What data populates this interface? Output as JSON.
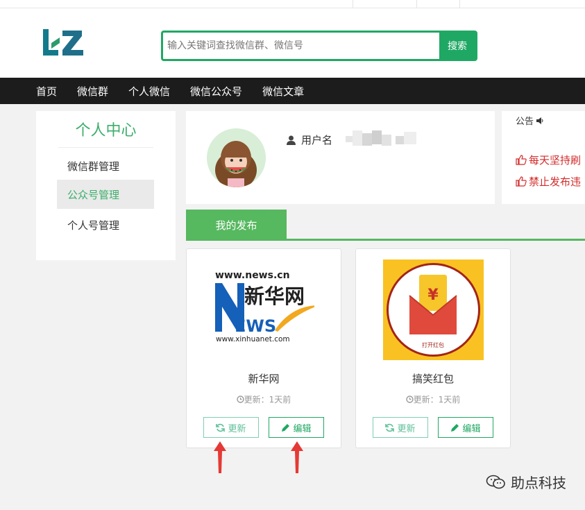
{
  "search": {
    "placeholder": "输入关键词查找微信群、微信号",
    "button": "搜索"
  },
  "nav": [
    "首页",
    "微信群",
    "个人微信",
    "微信公众号",
    "微信文章"
  ],
  "sidebar": {
    "title": "个人中心",
    "items": [
      {
        "label": "微信群管理",
        "active": false
      },
      {
        "label": "公众号管理",
        "active": true
      },
      {
        "label": "个人号管理",
        "active": false
      }
    ]
  },
  "profile": {
    "username_label": "用户名"
  },
  "notice": {
    "title": "公告",
    "lines": [
      "每天坚持刷",
      "禁止发布违"
    ]
  },
  "tabs": {
    "active": "我的发布"
  },
  "cards": [
    {
      "name": "新华网",
      "updated": "更新：1天前",
      "update_btn": "更新",
      "edit_btn": "编辑",
      "logo": {
        "url_top": "www.news.cn",
        "chinese": "新华网",
        "news": "EWS",
        "url_bottom": "www.xinhuanet.com"
      }
    },
    {
      "name": "搞笑红包",
      "updated": "更新：1天前",
      "update_btn": "更新",
      "edit_btn": "编辑",
      "image": {
        "symbol": "¥",
        "caption": "打开红包"
      }
    }
  ],
  "watermark": "助点科技",
  "colors": {
    "brand_green": "#1fa863",
    "tab_green": "#56b85f",
    "notice_red": "#d42a2a",
    "annotation_arrow": "#e53935"
  },
  "icons": [
    "user-icon",
    "speaker-icon",
    "thumbs-up-icon",
    "clock-icon",
    "refresh-icon",
    "pencil-icon",
    "wechat-icon"
  ]
}
